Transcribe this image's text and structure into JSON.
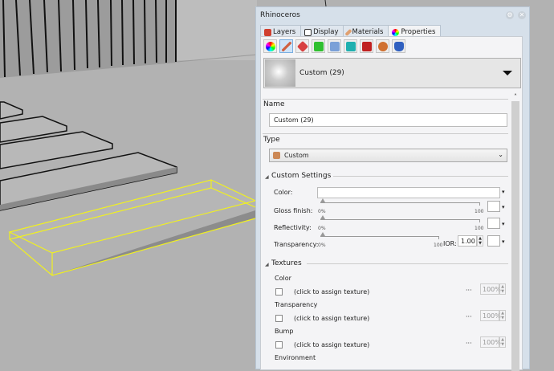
{
  "window": {
    "title": "Rhinoceros"
  },
  "tabs": [
    {
      "label": "Layers",
      "icon": "layers-icon"
    },
    {
      "label": "Display",
      "icon": "display-icon"
    },
    {
      "label": "Materials",
      "icon": "materials-icon"
    },
    {
      "label": "Properties",
      "icon": "properties-icon",
      "active": true
    }
  ],
  "property_icons": [
    {
      "name": "object-icon",
      "color": "#e04040"
    },
    {
      "name": "material-icon",
      "color": "#cde0f5"
    },
    {
      "name": "decal-icon",
      "color": "#d84040"
    },
    {
      "name": "texture-mapping-icon",
      "color": "#30c030"
    },
    {
      "name": "shadows-icon",
      "color": "#4a80d0"
    },
    {
      "name": "render-mesh-icon",
      "color": "#20b0b0"
    },
    {
      "name": "curve-piping-icon",
      "color": "#c02020"
    },
    {
      "name": "displacement-icon",
      "color": "#d07030"
    },
    {
      "name": "thickness-icon",
      "color": "#3060c0"
    }
  ],
  "material": {
    "selected": "Custom (29)"
  },
  "name_section": {
    "heading": "Name",
    "value": "Custom (29)"
  },
  "type_section": {
    "heading": "Type",
    "value": "Custom"
  },
  "custom_settings": {
    "heading": "Custom Settings",
    "color_label": "Color:",
    "gloss_label": "Gloss finish:",
    "reflect_label": "Reflectivity:",
    "transp_label": "Transparency:",
    "min": "0%",
    "max": "100",
    "gloss_value": 0,
    "reflect_value": 0,
    "transp_value": 0,
    "ior_label": "IOR:",
    "ior_value": "1.00"
  },
  "textures": {
    "heading": "Textures",
    "click_text": "(click to assign texture)",
    "more": "···",
    "items": [
      {
        "label": "Color",
        "amount": "100%"
      },
      {
        "label": "Transparency",
        "amount": "100%"
      },
      {
        "label": "Bump",
        "amount": "100%"
      },
      {
        "label": "Environment"
      }
    ]
  }
}
